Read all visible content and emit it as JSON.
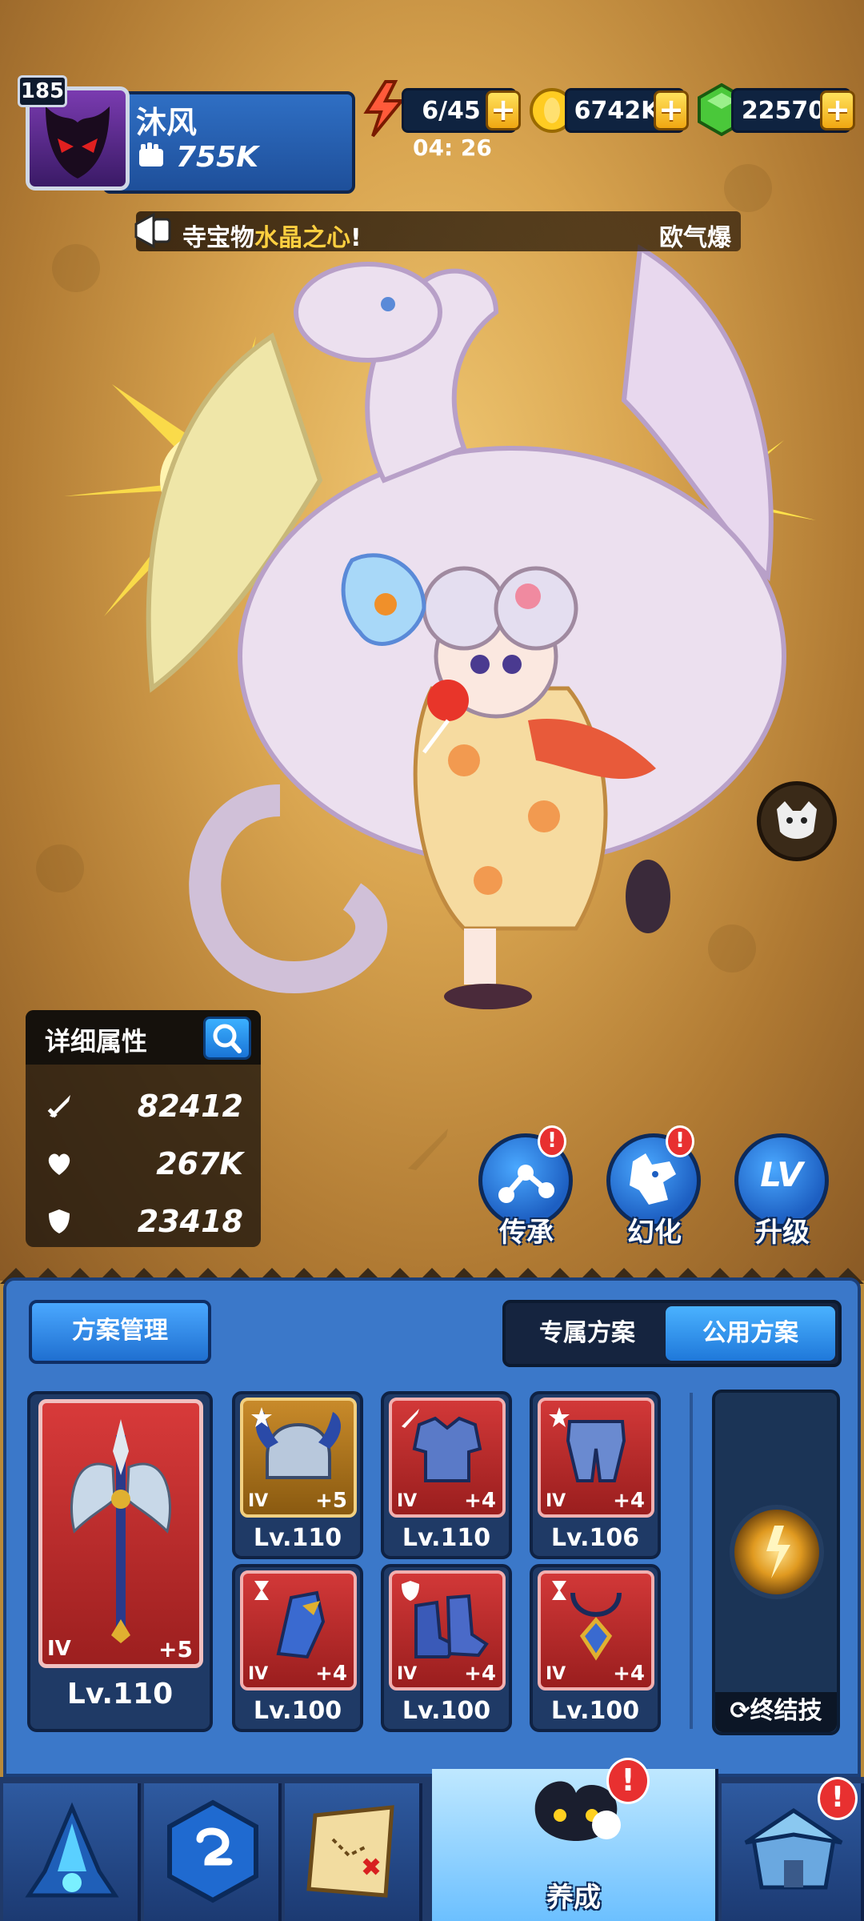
{
  "player": {
    "level": "185",
    "name": "沐风",
    "power": "755K"
  },
  "resources": {
    "energy": "6/45",
    "energy_timer": "04: 26",
    "gold": "6742K",
    "gems": "22570",
    "plus": "+"
  },
  "marquee": {
    "text_prefix": "寺宝物",
    "text_highlight": "水晶之心",
    "text_suffix": "!",
    "tag": "欧气爆"
  },
  "attributes": {
    "title": "详细属性",
    "attack": "82412",
    "hp": "267K",
    "defense": "23418"
  },
  "actions": [
    {
      "label": "传承",
      "badge": "!"
    },
    {
      "label": "幻化",
      "badge": "!"
    },
    {
      "label": "升级",
      "icon_text": "LV"
    }
  ],
  "equipment": {
    "plan_button": "方案管理",
    "tabs": [
      "专属方案",
      "公用方案"
    ],
    "active_tab": "公用方案",
    "weapon": {
      "tier": "IV",
      "plus": "+5",
      "level": "Lv.110"
    },
    "gear": [
      {
        "name": "helmet",
        "tier": "IV",
        "plus": "+5",
        "level": "Lv.110",
        "rarity": "gold"
      },
      {
        "name": "armor",
        "tier": "IV",
        "plus": "+4",
        "level": "Lv.110",
        "rarity": "red"
      },
      {
        "name": "pants",
        "tier": "IV",
        "plus": "+4",
        "level": "Lv.106",
        "rarity": "red"
      },
      {
        "name": "gauntlet",
        "tier": "IV",
        "plus": "+4",
        "level": "Lv.100",
        "rarity": "red"
      },
      {
        "name": "boots",
        "tier": "IV",
        "plus": "+4",
        "level": "Lv.100",
        "rarity": "red"
      },
      {
        "name": "necklace",
        "tier": "IV",
        "plus": "+4",
        "level": "Lv.100",
        "rarity": "red"
      }
    ],
    "ultimate_label": "终结技"
  },
  "nav": {
    "active_label": "养成",
    "badge": "!"
  },
  "colors": {
    "panel_blue": "#3b78c9",
    "gear_red": "#d23838",
    "gear_gold": "#c88a2a",
    "badge_red": "#e83030"
  }
}
